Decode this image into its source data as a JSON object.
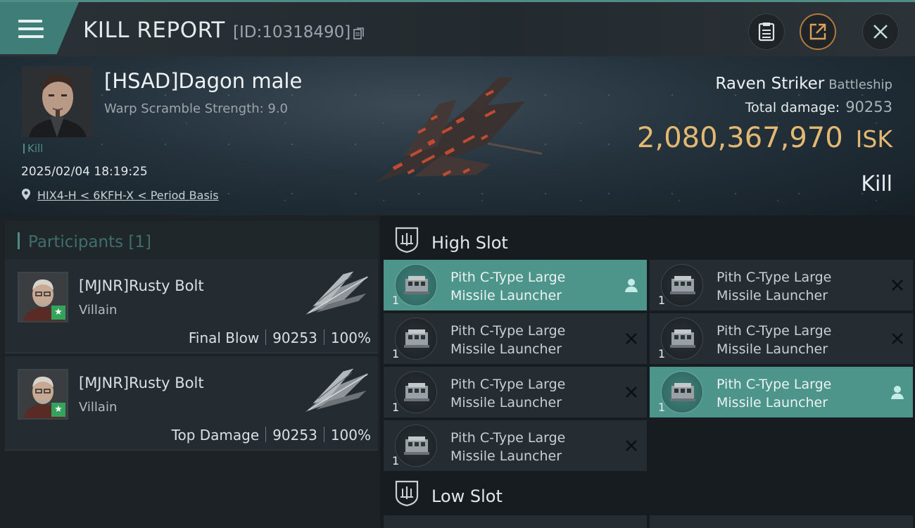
{
  "header": {
    "title": "KILL REPORT",
    "report_id": "[ID:10318490]"
  },
  "victim": {
    "name": "[HSAD]Dagon male",
    "warp_scramble": "Warp Scramble Strength: 9.0",
    "tag": "Kill",
    "datetime": "2025/02/04 18:19:25",
    "location": "HIX4-H < 6KFH-X < Period Basis"
  },
  "ship": {
    "name": "Raven Striker",
    "class": "Battleship",
    "total_damage_label": "Total damage:",
    "total_damage": "90253",
    "isk_value": "2,080,367,970",
    "isk_unit": "ISK",
    "result": "Kill"
  },
  "participants": {
    "label": "Participants [1]",
    "rows": [
      {
        "name": "[MJNR]Rusty Bolt",
        "title": "Villain",
        "role": "Final Blow",
        "damage": "90253",
        "percent": "100%"
      },
      {
        "name": "[MJNR]Rusty Bolt",
        "title": "Villain",
        "role": "Top Damage",
        "damage": "90253",
        "percent": "100%"
      }
    ]
  },
  "high_slot": {
    "label": "High Slot",
    "modules": [
      {
        "line1": "Pith C-Type Large",
        "line2": "Missile Launcher",
        "qty": "1",
        "state": "active"
      },
      {
        "line1": "Pith C-Type Large",
        "line2": "Missile Launcher",
        "qty": "1",
        "state": "destroyed"
      },
      {
        "line1": "Pith C-Type Large",
        "line2": "Missile Launcher",
        "qty": "1",
        "state": "destroyed"
      },
      {
        "line1": "Pith C-Type Large",
        "line2": "Missile Launcher",
        "qty": "1",
        "state": "destroyed"
      },
      {
        "line1": "Pith C-Type Large",
        "line2": "Missile Launcher",
        "qty": "1",
        "state": "destroyed"
      },
      {
        "line1": "Pith C-Type Large",
        "line2": "Missile Launcher",
        "qty": "1",
        "state": "active"
      },
      {
        "line1": "Pith C-Type Large",
        "line2": "Missile Launcher",
        "qty": "1",
        "state": "destroyed"
      }
    ]
  },
  "low_slot": {
    "label": "Low Slot"
  },
  "colors": {
    "accent": "#4f8c86",
    "isk": "#e3b872",
    "active_module": "#4d948b"
  }
}
